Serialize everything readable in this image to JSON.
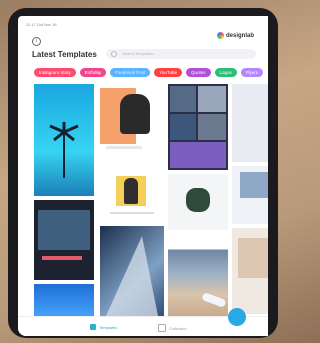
{
  "status_bar": "11:17 Sat Nov 16",
  "brand": {
    "name": "designlab"
  },
  "header": {
    "title": "Latest Templates",
    "search_placeholder": "Search templates..."
  },
  "tags": [
    {
      "label": "Instagram Story",
      "color": "#ff4b6e"
    },
    {
      "label": "Birthday",
      "color": "#f0468c"
    },
    {
      "label": "Facebook Post",
      "color": "#5ab4ff"
    },
    {
      "label": "YouTube",
      "color": "#ff4040"
    },
    {
      "label": "Quotes",
      "color": "#b04fd8"
    },
    {
      "label": "Logos",
      "color": "#2bbf7a"
    },
    {
      "label": "Flyers",
      "color": "#b486ff"
    }
  ],
  "nav": {
    "templates": "Templates",
    "collection": "Collection"
  }
}
